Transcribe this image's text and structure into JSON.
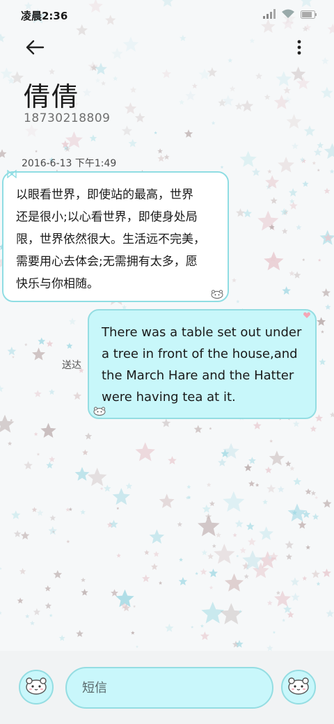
{
  "status_bar": {
    "time": "凌晨2:36",
    "icons": [
      "signal-icon",
      "wifi-icon",
      "battery-icon"
    ]
  },
  "header": {
    "back_icon": "arrow-left-icon",
    "more_icon": "more-vertical-icon",
    "contact_name": "倩倩",
    "contact_phone": "18730218809"
  },
  "conversation": {
    "timestamp": "2016-6-13 下午1:49",
    "messages": [
      {
        "direction": "incoming",
        "lines": [
          "以眼看世界，即使站的最高，世界",
          "还是很小;以心看世界，即使身处局",
          "限，世界依然很大。生活远不完美，",
          "需要用心去体会;无需拥有太多，愿",
          "快乐与你相随。"
        ]
      },
      {
        "direction": "outgoing",
        "lines": [
          "There was a table set out under",
          "a tree in front of the house,and",
          "the March Hare and the Hatter",
          "were having tea at it."
        ],
        "status": "送达"
      }
    ]
  },
  "composer": {
    "placeholder": "短信",
    "left_icon": "sticker-icon",
    "right_icon": "send-icon"
  },
  "colors": {
    "bubble_border": "#94dde2",
    "bubble_out_fill": "#c8f7fa",
    "background": "#f6f8f9"
  }
}
